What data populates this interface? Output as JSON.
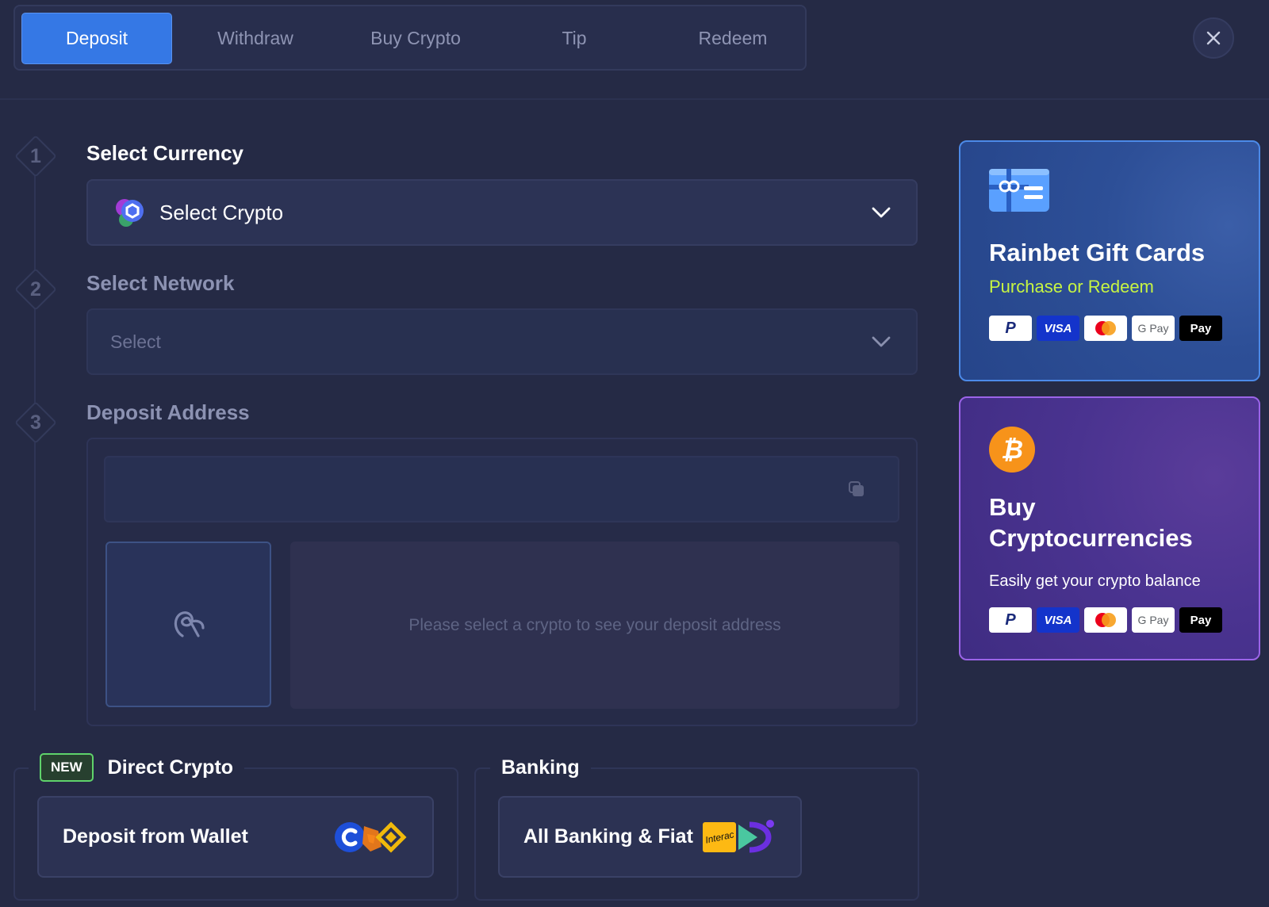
{
  "tabs": {
    "deposit": "Deposit",
    "withdraw": "Withdraw",
    "buy_crypto": "Buy Crypto",
    "tip": "Tip",
    "redeem": "Redeem"
  },
  "steps": {
    "one": {
      "number": "1",
      "title": "Select Currency",
      "value": "Select Crypto"
    },
    "two": {
      "number": "2",
      "title": "Select Network",
      "placeholder": "Select"
    },
    "three": {
      "number": "3",
      "title": "Deposit Address",
      "message": "Please select a crypto to see your deposit address"
    }
  },
  "direct_crypto": {
    "badge": "NEW",
    "title": "Direct Crypto",
    "button": "Deposit from Wallet"
  },
  "banking": {
    "title": "Banking",
    "button": "All Banking & Fiat",
    "interac": "Interac"
  },
  "gift_card": {
    "title": "Rainbet Gift Cards",
    "subtitle": "Purchase or Redeem"
  },
  "buy_card": {
    "title_line1": "Buy",
    "title_line2": "Cryptocurrencies",
    "subtitle": "Easily get your crypto balance"
  },
  "payment_methods": {
    "paypal": "P",
    "visa": "VISA",
    "gpay": "G Pay",
    "applepay": "Pay"
  },
  "colors": {
    "background": "#252a45",
    "accent": "#3578e5",
    "gift_subtitle": "#c7f542",
    "new_badge": "#5fd36b",
    "bitcoin": "#f7931a"
  }
}
